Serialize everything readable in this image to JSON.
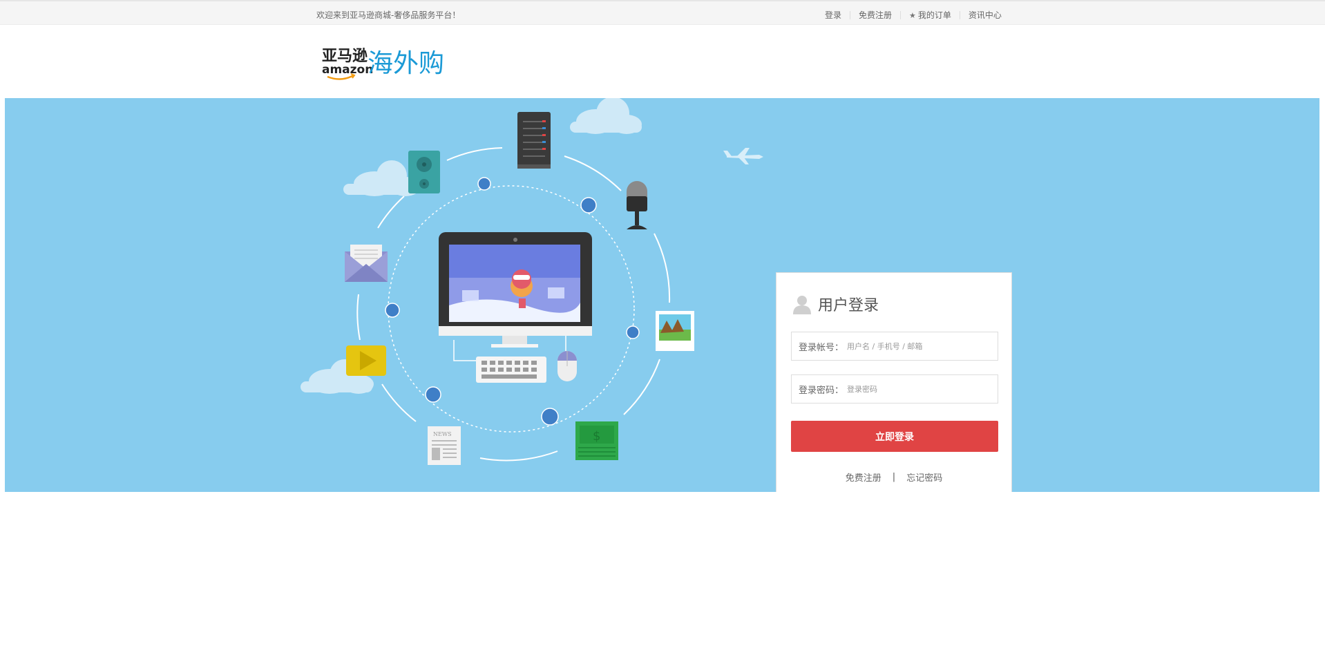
{
  "topbar": {
    "welcome": "欢迎来到亚马逊商城-奢侈品服务平台！",
    "links": {
      "login": "登录",
      "register": "免费注册",
      "orders": "我的订单",
      "news": "资讯中心"
    }
  },
  "logo": {
    "brand_cn": "亚马逊",
    "brand_en": "amazon",
    "sub": "海外购"
  },
  "illustration": {
    "news_label": "NEWS",
    "money_symbol": "$"
  },
  "login": {
    "title": "用户登录",
    "account_label": "登录帐号：",
    "account_placeholder": "用户名 / 手机号 / 邮箱",
    "password_label": "登录密码：",
    "password_placeholder": "登录密码",
    "submit": "立即登录",
    "register_link": "免费注册",
    "divider": "|",
    "forgot_link": "忘记密码"
  },
  "colors": {
    "banner_bg": "#87ccee",
    "login_button": "#e04444",
    "logo_blue": "#1b9ad6"
  }
}
